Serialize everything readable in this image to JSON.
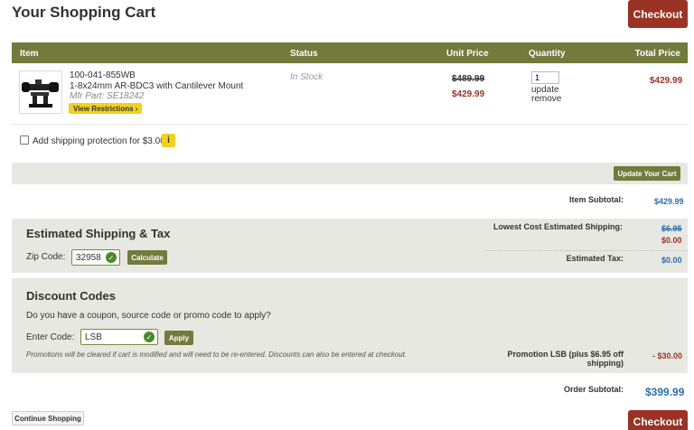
{
  "page": {
    "title": "Your Shopping Cart",
    "checkout_label": "Checkout"
  },
  "table": {
    "headers": {
      "item": "Item",
      "status": "Status",
      "unit_price": "Unit Price",
      "quantity": "Quantity",
      "total_price": "Total Price"
    }
  },
  "product": {
    "sku": "100-041-855WB",
    "name": "1-8x24mm AR-BDC3 with Cantilever Mount",
    "mfr_part": "Mfr Part: SE18242",
    "restrictions_label": "View Restrictions ›",
    "status": "In Stock",
    "price_original": "$489.99",
    "price_sale": "$429.99",
    "quantity": "1",
    "update_label": "update",
    "remove_label": "remove",
    "total": "$429.99"
  },
  "shipping_protection": {
    "label": "Add shipping protection for $3.00",
    "info_icon": "i"
  },
  "update_cart_label": "Update Your Cart",
  "summary": {
    "item_subtotal_label": "Item Subtotal:",
    "item_subtotal": "$429.99",
    "lowest_shipping_label": "Lowest Cost Estimated Shipping:",
    "shipping_original": "$6.95",
    "shipping_current": "$0.00",
    "estimated_tax_label": "Estimated Tax:",
    "estimated_tax": "$0.00",
    "promotion_label": "Promotion LSB (plus $6.95 off shipping)",
    "promotion_value": "- $30.00",
    "order_subtotal_label": "Order Subtotal:",
    "order_subtotal": "$399.99"
  },
  "estimate": {
    "title": "Estimated Shipping & Tax",
    "zip_label": "Zip Code:",
    "zip_value": "32958",
    "calculate_label": "Calculate"
  },
  "discount": {
    "title": "Discount Codes",
    "question": "Do you have a coupon, source code or promo code to apply?",
    "code_label": "Enter Code:",
    "code_value": "LSB",
    "apply_label": "Apply",
    "note": "Promotions will be cleared if cart is modified and will need to be re-entered. Discounts can also be entered at checkout."
  },
  "continue_label": "Continue Shopping",
  "colors": {
    "header_bg": "#727a3c",
    "checkout_bg": "#9c3223",
    "band_bg": "#e7e8e1",
    "accent_blue": "#2d6fb0"
  }
}
